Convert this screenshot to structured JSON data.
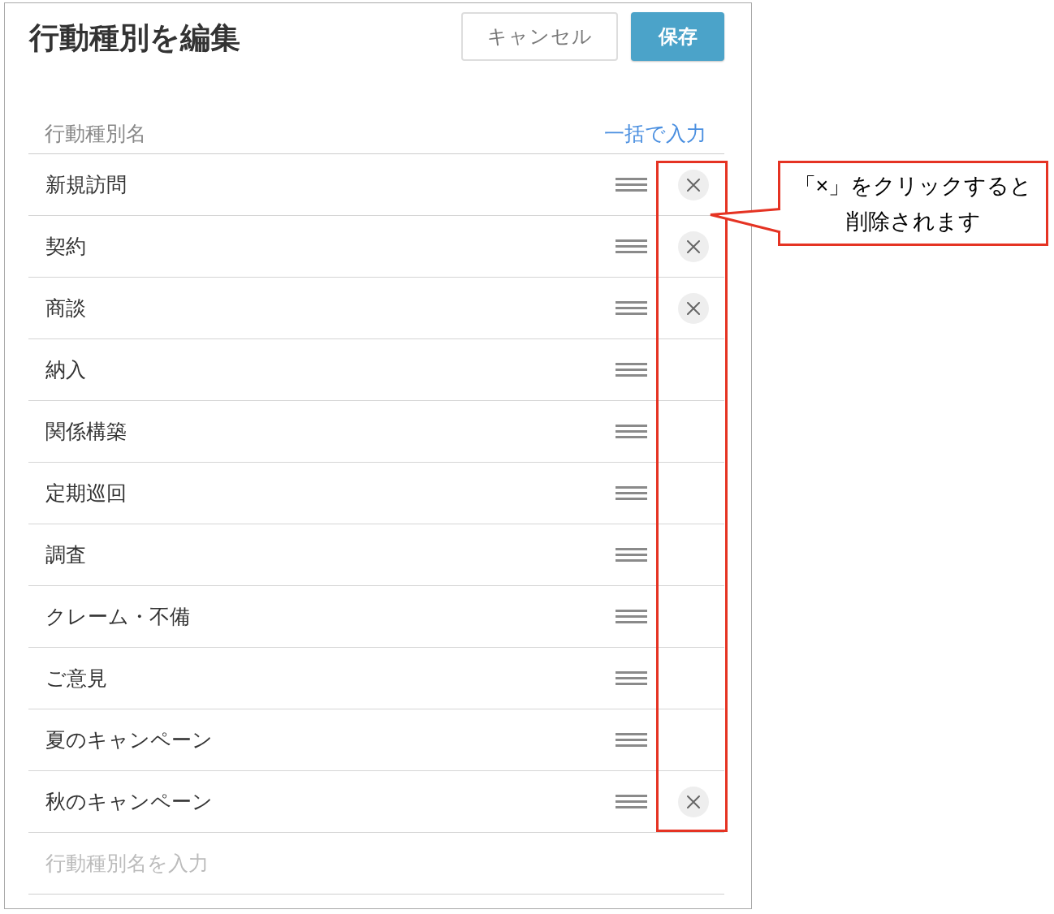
{
  "dialog": {
    "title": "行動種別を編集",
    "buttons": [
      {
        "label": "キャンセル",
        "kind": "secondary"
      },
      {
        "label": "保存",
        "kind": "primary"
      }
    ]
  },
  "list": {
    "column_header": "行動種別名",
    "bulk_input_link": "一括で入力",
    "rows": [
      {
        "name": "新規訪問",
        "deletable": true
      },
      {
        "name": "契約",
        "deletable": true
      },
      {
        "name": "商談",
        "deletable": true
      },
      {
        "name": "納入",
        "deletable": false
      },
      {
        "name": "関係構築",
        "deletable": false
      },
      {
        "name": "定期巡回",
        "deletable": false
      },
      {
        "name": "調査",
        "deletable": false
      },
      {
        "name": "クレーム・不備",
        "deletable": false
      },
      {
        "name": "ご意見",
        "deletable": false
      },
      {
        "name": "夏のキャンペーン",
        "deletable": false
      },
      {
        "name": "秋のキャンペーン",
        "deletable": true
      }
    ],
    "new_item_field": {
      "placeholder": "行動種別名を入力"
    }
  },
  "annotation": {
    "lines": [
      "「×」をクリックすると",
      "削除されます"
    ]
  }
}
